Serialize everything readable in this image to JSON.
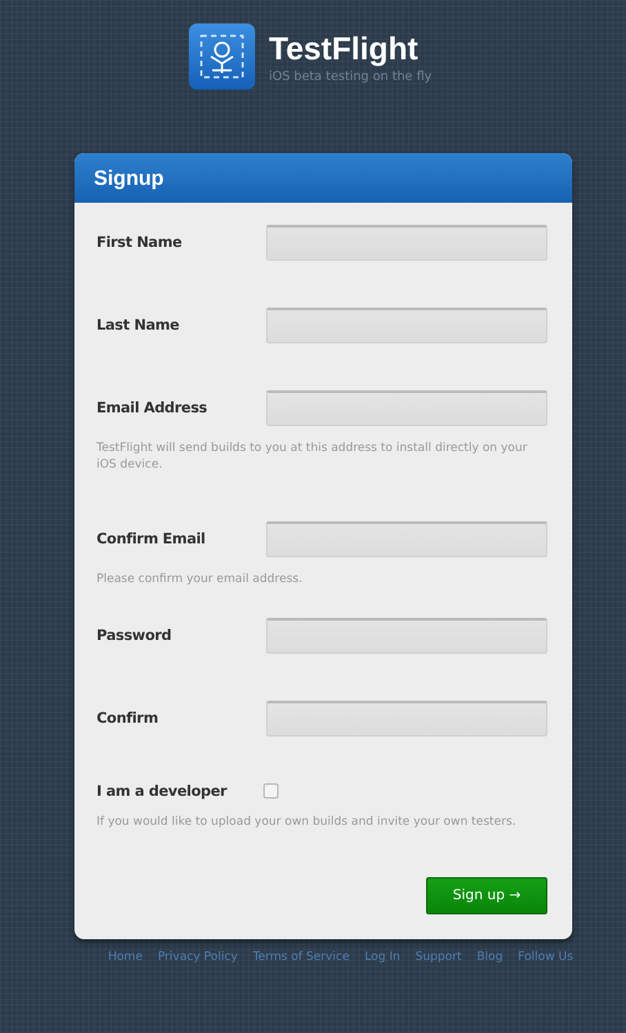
{
  "brand": {
    "name": "TestFlight",
    "tagline": "iOS beta testing on the fly"
  },
  "form": {
    "title": "Signup",
    "rows": [
      {
        "kind": "text",
        "label": "First Name"
      },
      {
        "kind": "text",
        "label": "Last Name"
      },
      {
        "kind": "text",
        "label": "Email Address",
        "help": "TestFlight will send builds to you at this address to install directly on your iOS device."
      },
      {
        "kind": "text",
        "label": "Confirm Email",
        "help": "Please confirm your email address."
      },
      {
        "kind": "text",
        "label": "Password"
      },
      {
        "kind": "text",
        "label": "Confirm"
      },
      {
        "kind": "checkbox",
        "label": "I am a developer",
        "checked": false,
        "help": "If you would like to upload your own builds and invite your own testers."
      }
    ],
    "submit": "Sign up →"
  },
  "footer_links": [
    "Home",
    "Privacy Policy",
    "Terms of Service",
    "Log In",
    "Support",
    "Blog",
    "Follow Us"
  ]
}
